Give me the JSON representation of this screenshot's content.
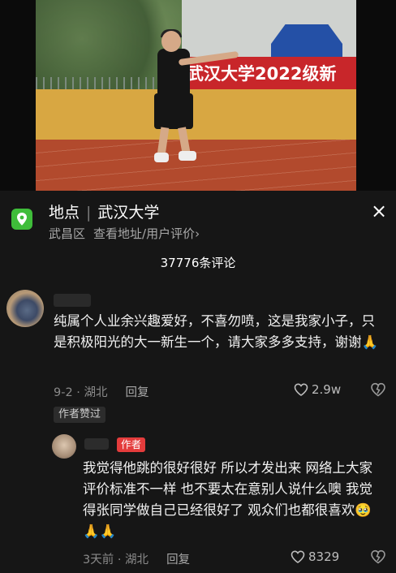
{
  "video": {
    "banner_text": "武汉大学2022级新"
  },
  "location": {
    "label": "地点",
    "name": "武汉大学",
    "district": "武昌区",
    "link": "查看地址/用户评价",
    "chevron": "›"
  },
  "close_icon": "×",
  "comments_count": "37776条评论",
  "comments": [
    {
      "text": "纯属个人业余兴趣爱好，不喜勿喷，这是我家小子，只是积极阳光的大一新生一个，请大家多多支持，谢谢🙏",
      "date_region": "9-2 · 湖北",
      "reply_label": "回复",
      "likes": "2.9w",
      "badge": "作者赞过"
    },
    {
      "author_tag": "作者",
      "text": "我觉得他跳的很好很好 所以才发出来 网络上大家评价标准不一样 也不要太在意别人说什么噢 我觉得张同学做自己已经很好了 观众们也都很喜欢🥹🙏🙏",
      "date_region": "3天前 · 湖北",
      "reply_label": "回复",
      "likes": "8329"
    }
  ],
  "colors": {
    "background": "#161616",
    "location_icon": "#3fbd3a",
    "author_tag": "#e43c3c"
  },
  "icons": [
    "location-pin-icon",
    "close-icon",
    "heart-icon",
    "dislike-icon"
  ]
}
